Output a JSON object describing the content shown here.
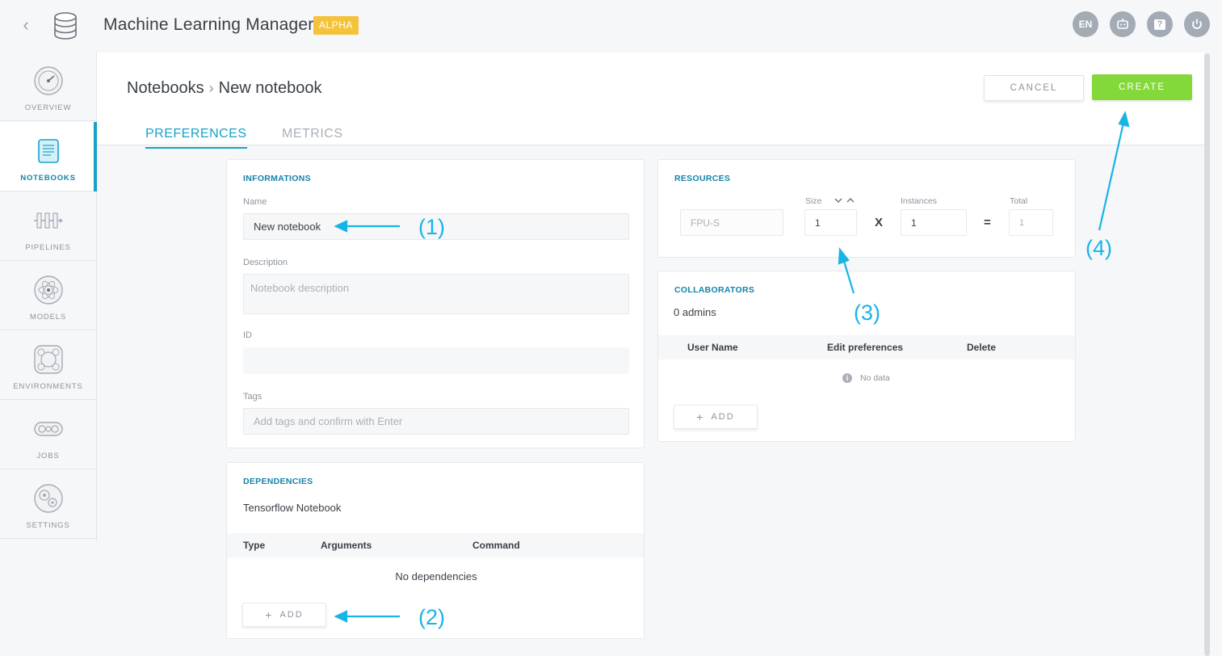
{
  "app": {
    "title": "Machine Learning Manager",
    "badge": "ALPHA"
  },
  "top_icons": [
    {
      "label": "EN",
      "icon": "language-icon"
    },
    {
      "label": "",
      "icon": "bot-icon"
    },
    {
      "label": "?",
      "icon": "help-icon"
    },
    {
      "label": "",
      "icon": "power-icon"
    }
  ],
  "sidebar": {
    "items": [
      {
        "label": "OVERVIEW",
        "icon": "gauge-icon"
      },
      {
        "label": "NOTEBOOKS",
        "icon": "notebook-icon",
        "active": true
      },
      {
        "label": "PIPELINES",
        "icon": "pipeline-icon"
      },
      {
        "label": "MODELS",
        "icon": "atom-icon"
      },
      {
        "label": "ENVIRONMENTS",
        "icon": "environment-icon"
      },
      {
        "label": "JOBS",
        "icon": "gear-train-icon"
      },
      {
        "label": "SETTINGS",
        "icon": "settings-gears-icon"
      }
    ]
  },
  "breadcrumb": {
    "parent": "Notebooks",
    "current": "New notebook"
  },
  "actions": {
    "cancel": "CANCEL",
    "create": "CREATE"
  },
  "tabs": [
    {
      "label": "PREFERENCES",
      "active": true
    },
    {
      "label": "METRICS",
      "active": false
    }
  ],
  "informations": {
    "title": "INFORMATIONS",
    "name_label": "Name",
    "name_value": "New notebook",
    "description_label": "Description",
    "description_placeholder": "Notebook description",
    "id_label": "ID",
    "id_value": "",
    "tags_label": "Tags",
    "tags_placeholder": "Add tags and confirm with Enter"
  },
  "dependencies": {
    "title": "DEPENDENCIES",
    "subtitle": "Tensorflow Notebook",
    "columns": [
      "Type",
      "Arguments",
      "Command"
    ],
    "empty": "No dependencies",
    "add_label": "ADD"
  },
  "resources": {
    "title": "RESOURCES",
    "flavor": "FPU-S",
    "size_label": "Size",
    "size_value": "1",
    "instances_label": "Instances",
    "instances_value": "1",
    "total_label": "Total",
    "total_value": "1",
    "times_symbol": "X",
    "equals_symbol": "="
  },
  "collaborators": {
    "title": "COLLABORATORS",
    "count": "0 admins",
    "columns": [
      "User Name",
      "Edit preferences",
      "Delete"
    ],
    "empty": "No data",
    "add_label": "ADD"
  },
  "annotations": [
    "(1)",
    "(2)",
    "(3)",
    "(4)"
  ],
  "colors": {
    "accent": "#17a2c8",
    "create": "#83d93a",
    "badge": "#f5c33b",
    "annotation": "#18b4e6"
  }
}
